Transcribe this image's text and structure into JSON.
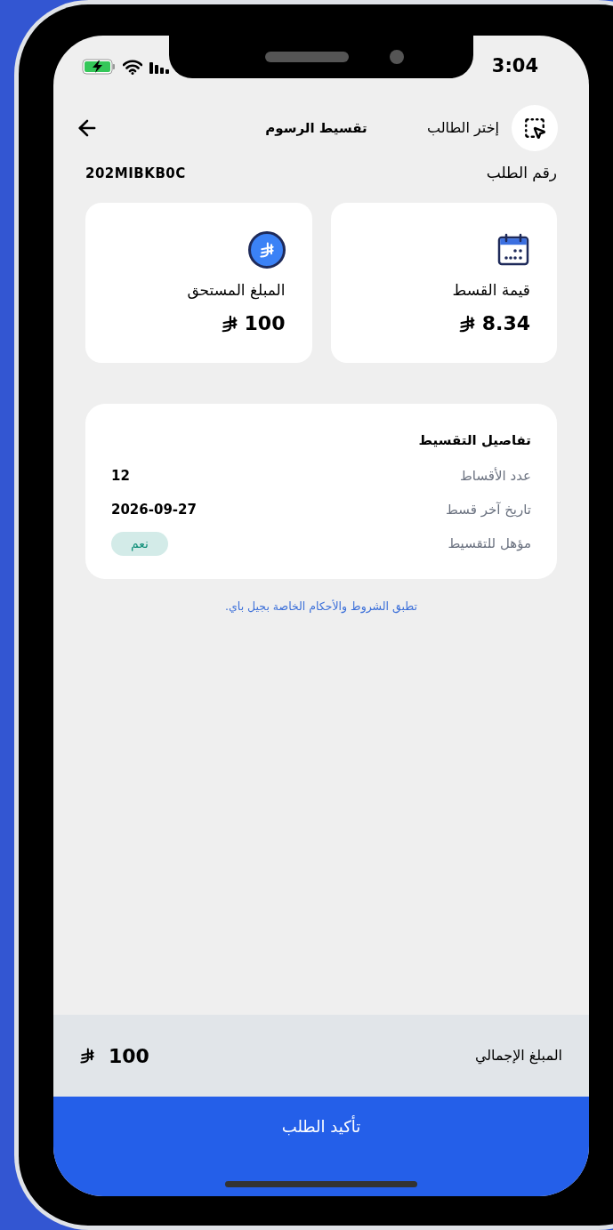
{
  "status_bar": {
    "time": "3:04"
  },
  "header": {
    "title": "تقسيط الرسوم",
    "select_student": "إختر الطالب"
  },
  "order": {
    "label": "رقم الطلب",
    "value": "202MIBKB0C"
  },
  "summary_cards": [
    {
      "kind": "installment",
      "label": "قيمة القسط",
      "amount": "8.34"
    },
    {
      "kind": "due",
      "label": "المبلغ المستحق",
      "amount": "100"
    }
  ],
  "details": {
    "title": "تفاصيل التقسيط",
    "rows": [
      {
        "kind": "text",
        "label": "عدد الأقساط",
        "value": "12"
      },
      {
        "kind": "text",
        "label": "تاريخ آخر قسط",
        "value": "2026-09-27"
      },
      {
        "kind": "badge",
        "label": "مؤهل للتقسيط",
        "value": "نعم"
      }
    ]
  },
  "terms_note": "تطبق الشروط والأحكام الخاصة بجيل باي.",
  "total": {
    "label": "المبلغ الإجمالي",
    "amount": "100"
  },
  "confirm_button": "تأكيد الطلب"
}
